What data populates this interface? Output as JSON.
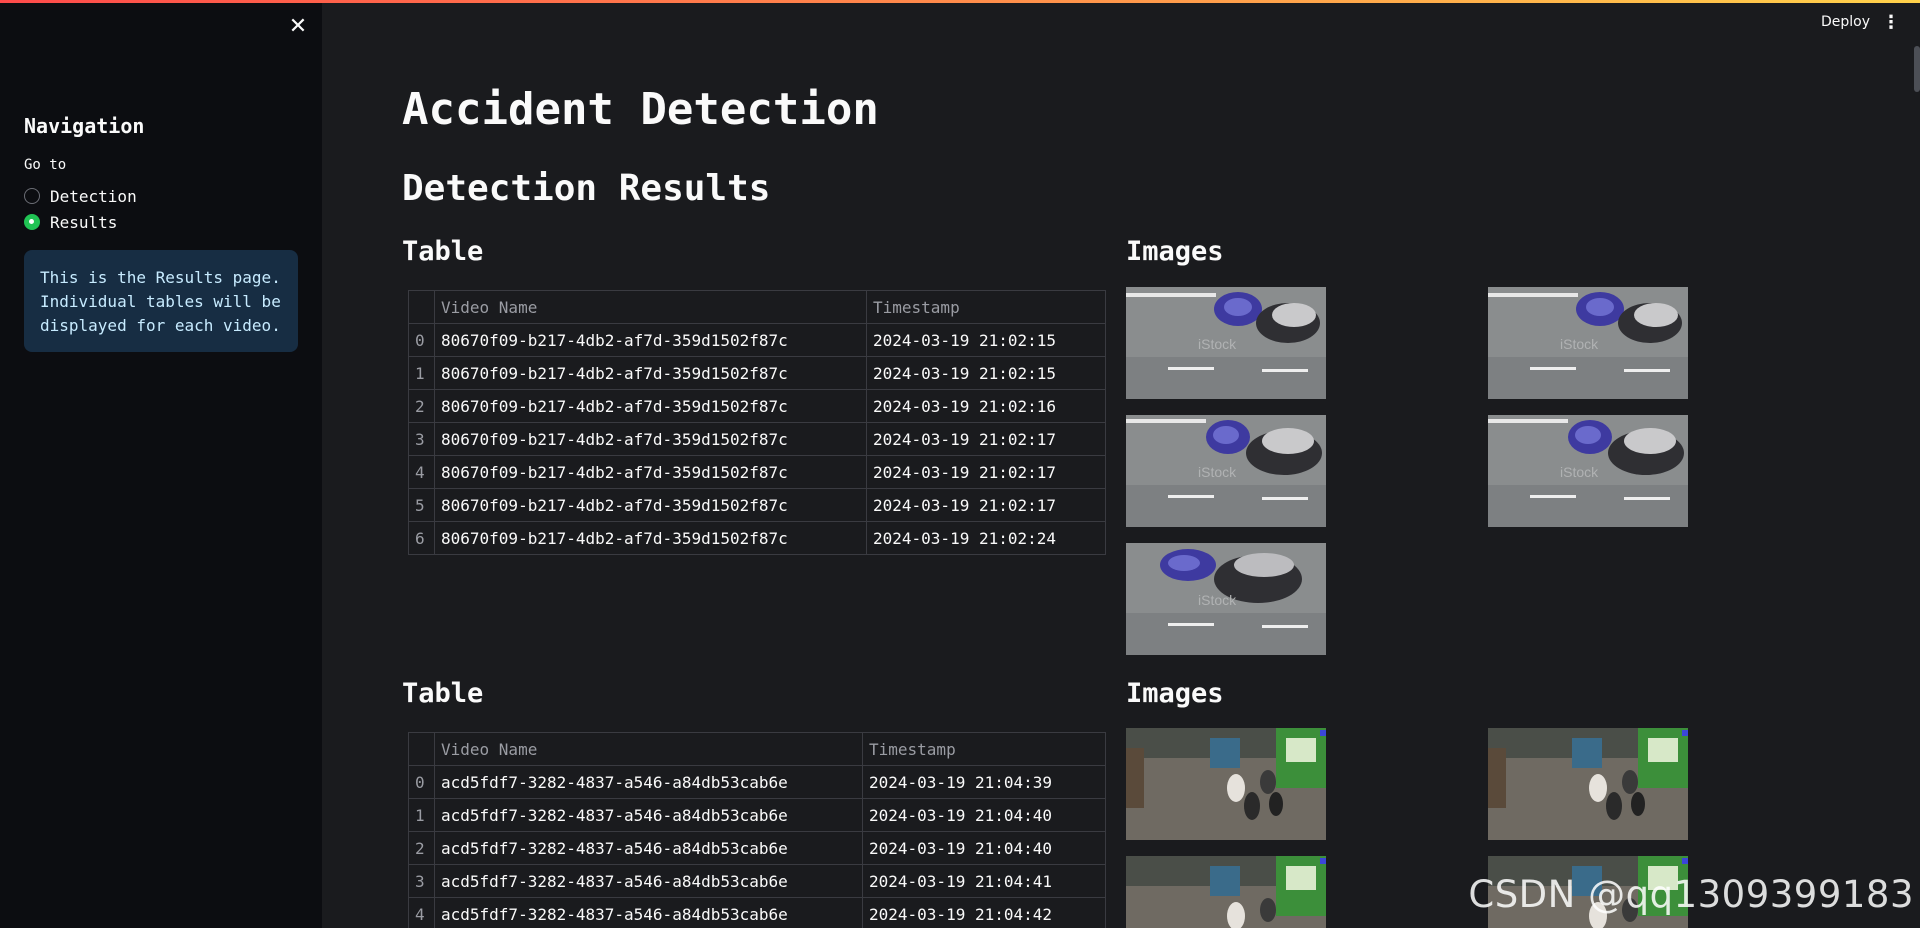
{
  "sidebar": {
    "close_icon": "close-icon",
    "title": "Navigation",
    "radio_label": "Go to",
    "options": [
      {
        "label": "Detection",
        "selected": false
      },
      {
        "label": "Results",
        "selected": true
      }
    ],
    "info": "This is the Results page. Individual tables will be displayed for each video."
  },
  "header": {
    "deploy": "Deploy",
    "menu_icon": "⋮"
  },
  "main": {
    "title": "Accident Detection",
    "subheader": "Detection Results",
    "sections": [
      {
        "table_title": "Table",
        "images_title": "Images",
        "columns": [
          "",
          "Video Name",
          "Timestamp"
        ],
        "rows": [
          [
            "0",
            "80670f09-b217-4db2-af7d-359d1502f87c",
            "2024-03-19 21:02:15"
          ],
          [
            "1",
            "80670f09-b217-4db2-af7d-359d1502f87c",
            "2024-03-19 21:02:15"
          ],
          [
            "2",
            "80670f09-b217-4db2-af7d-359d1502f87c",
            "2024-03-19 21:02:16"
          ],
          [
            "3",
            "80670f09-b217-4db2-af7d-359d1502f87c",
            "2024-03-19 21:02:17"
          ],
          [
            "4",
            "80670f09-b217-4db2-af7d-359d1502f87c",
            "2024-03-19 21:02:17"
          ],
          [
            "5",
            "80670f09-b217-4db2-af7d-359d1502f87c",
            "2024-03-19 21:02:17"
          ],
          [
            "6",
            "80670f09-b217-4db2-af7d-359d1502f87c",
            "2024-03-19 21:02:24"
          ]
        ]
      },
      {
        "table_title": "Table",
        "images_title": "Images",
        "columns": [
          "",
          "Video Name",
          "Timestamp"
        ],
        "rows": [
          [
            "0",
            "acd5fdf7-3282-4837-a546-a84db53cab6e",
            "2024-03-19 21:04:39"
          ],
          [
            "1",
            "acd5fdf7-3282-4837-a546-a84db53cab6e",
            "2024-03-19 21:04:40"
          ],
          [
            "2",
            "acd5fdf7-3282-4837-a546-a84db53cab6e",
            "2024-03-19 21:04:40"
          ],
          [
            "3",
            "acd5fdf7-3282-4837-a546-a84db53cab6e",
            "2024-03-19 21:04:41"
          ],
          [
            "4",
            "acd5fdf7-3282-4837-a546-a84db53cab6e",
            "2024-03-19 21:04:42"
          ]
        ]
      }
    ]
  },
  "watermark": "CSDN @qq1309399183",
  "colors": {
    "accent": "#ff4b4b",
    "radio_selected": "#21c354",
    "info_bg": "#172d43",
    "main_bg": "#1a1b1e",
    "sidebar_bg": "#0c0d11"
  }
}
